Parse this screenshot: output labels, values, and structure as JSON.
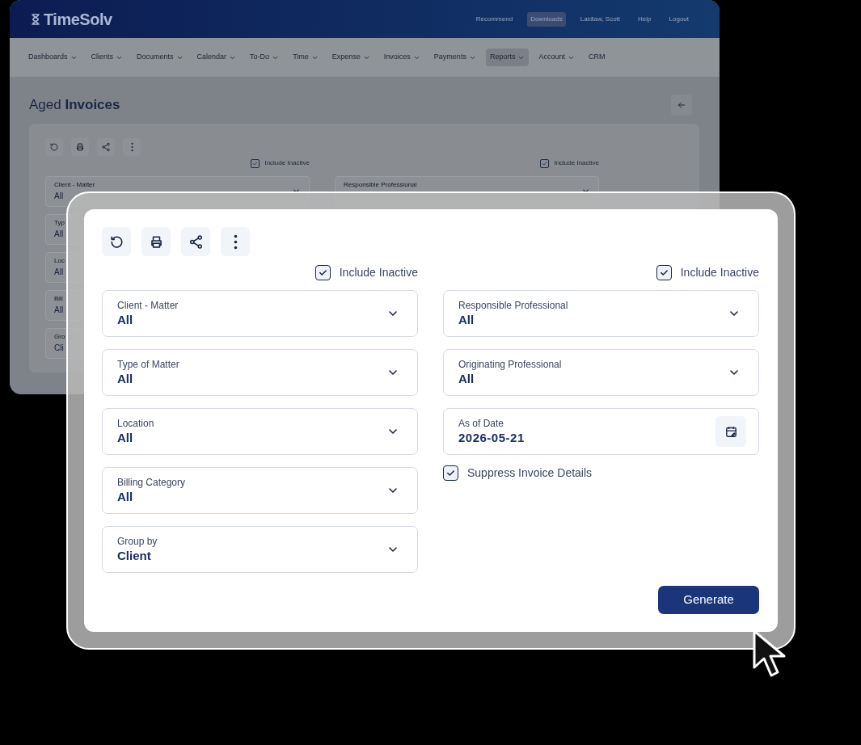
{
  "background_window": {
    "logo": "TimeSolv",
    "top_links": [
      {
        "label": "Recommend",
        "selected": false
      },
      {
        "label": "Downloads",
        "selected": true
      },
      {
        "label": "Laidlaw, Scott",
        "selected": false
      },
      {
        "label": "Help",
        "selected": false
      },
      {
        "label": "Logout",
        "selected": false
      }
    ],
    "nav": [
      {
        "label": "Dashboards",
        "has_menu": true,
        "selected": false
      },
      {
        "label": "Clients",
        "has_menu": true,
        "selected": false
      },
      {
        "label": "Documents",
        "has_menu": true,
        "selected": false
      },
      {
        "label": "Calendar",
        "has_menu": true,
        "selected": false
      },
      {
        "label": "To-Do",
        "has_menu": true,
        "selected": false
      },
      {
        "label": "Time",
        "has_menu": true,
        "selected": false
      },
      {
        "label": "Expense",
        "has_menu": true,
        "selected": false
      },
      {
        "label": "Invoices",
        "has_menu": true,
        "selected": false
      },
      {
        "label": "Payments",
        "has_menu": true,
        "selected": false
      },
      {
        "label": "Reports",
        "has_menu": true,
        "selected": true
      },
      {
        "label": "Account",
        "has_menu": true,
        "selected": false
      },
      {
        "label": "CRM",
        "has_menu": false,
        "selected": false
      }
    ],
    "page_title": "Aged **Invoices**",
    "include_inactive": [
      {
        "label": "Include Inactive",
        "checked": true
      },
      {
        "label": "Include Inactive",
        "checked": true
      }
    ],
    "left_fields": [
      {
        "label": "Client - Matter",
        "value": "All"
      },
      {
        "label": "Typ",
        "value": "All"
      },
      {
        "label": "Loc",
        "value": "All"
      },
      {
        "label": "Bill",
        "value": "All"
      },
      {
        "label": "Gro",
        "value": "Cli"
      }
    ],
    "right_fields": [
      {
        "label": "Responsible Professional"
      }
    ]
  },
  "report_panel": {
    "include_inactive": [
      {
        "label": "Include Inactive",
        "checked": true
      },
      {
        "label": "Include Inactive",
        "checked": true
      }
    ],
    "left_fields": [
      {
        "kind": "dropdown",
        "label": "Client - Matter",
        "value": "All"
      },
      {
        "kind": "dropdown",
        "label": "Type of Matter",
        "value": "All"
      },
      {
        "kind": "dropdown",
        "label": "Location",
        "value": "All"
      },
      {
        "kind": "dropdown",
        "label": "Billing Category",
        "value": "All"
      },
      {
        "kind": "dropdown",
        "label": "Group by",
        "value": "Client"
      }
    ],
    "right_fields": [
      {
        "kind": "dropdown",
        "label": "Responsible Professional",
        "value": "All"
      },
      {
        "kind": "dropdown",
        "label": "Originating Professional",
        "value": "All"
      },
      {
        "kind": "date",
        "label": "As of Date",
        "value": "2026-05-21"
      }
    ],
    "suppress_invoice_details": {
      "label": "Suppress Invoice Details",
      "checked": true
    },
    "generate_button": "Generate"
  }
}
